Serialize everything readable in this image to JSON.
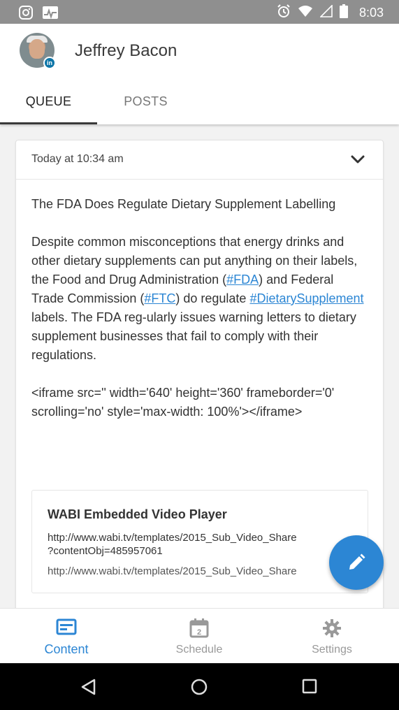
{
  "status_bar": {
    "time": "8:03",
    "left_icons": [
      "instagram-icon",
      "activity-icon"
    ],
    "right_icons": [
      "alarm-icon",
      "wifi-icon",
      "signal-icon",
      "battery-icon"
    ]
  },
  "profile": {
    "name": "Jeffrey Bacon",
    "network_badge": "in"
  },
  "tabs": [
    {
      "label": "QUEUE",
      "active": true
    },
    {
      "label": "POSTS",
      "active": false
    }
  ],
  "post": {
    "scheduled_time": "Today at 10:34 am",
    "title_line": "The FDA Does Regulate Dietary Supplement Labelling",
    "para_start": "Despite common misconceptions that energy drinks and other dietary supplements can put anything on their labels, the Food and Drug Administration (",
    "hashtag_fda": "#FDA",
    "para_mid1": ") and Federal Trade Commission (",
    "hashtag_ftc": "#FTC",
    "para_mid2": ") do regulate ",
    "hashtag_supplement": "#DietarySupplement",
    "para_end": " labels. The FDA reg-ularly issues warning letters to dietary supplement businesses that fail to comply with their regulations.",
    "embed_code": "<iframe src='' width='640' height='360' frameborder='0' scrolling='no' style='max-width: 100%'></iframe>"
  },
  "link_preview": {
    "title": "WABI Embedded Video Player",
    "url_full": "http://www.wabi.tv/templates/2015_Sub_Video_Share\n?contentObj=485957061",
    "url_short": "http://www.wabi.tv/templates/2015_Sub_Video_Share"
  },
  "bottom_nav": [
    {
      "label": "Content",
      "icon": "content-icon",
      "active": true
    },
    {
      "label": "Schedule",
      "icon": "calendar-icon",
      "badge": "2",
      "active": false
    },
    {
      "label": "Settings",
      "icon": "gear-icon",
      "active": false
    }
  ],
  "colors": {
    "accent": "#2c86d4",
    "status_bar": "#8f8f8f",
    "inactive": "#999999"
  }
}
